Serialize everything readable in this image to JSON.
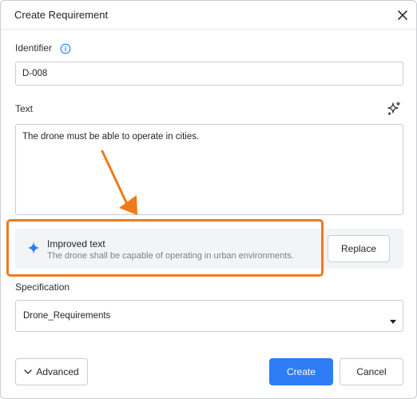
{
  "dialog": {
    "title": "Create Requirement",
    "close_icon": "close-icon"
  },
  "identifier": {
    "label": "Identifier",
    "info_icon": "info-icon",
    "value": "D-008"
  },
  "text_field": {
    "label": "Text",
    "ai_icon": "sparkle-icon",
    "value": "The drone must be able to operate in cities."
  },
  "suggestion": {
    "icon": "sparkle-icon",
    "title": "Improved text",
    "text": "The drone shall be capable of operating in urban environments.",
    "replace_label": "Replace",
    "highlight_color": "#f07a1a"
  },
  "specification": {
    "label": "Specification",
    "selected": "Drone_Requirements",
    "caret_icon": "caret-down-icon"
  },
  "footer": {
    "advanced_label": "Advanced",
    "advanced_icon": "chevron-down-icon",
    "create_label": "Create",
    "cancel_label": "Cancel"
  },
  "colors": {
    "primary": "#2f7df6",
    "annotation": "#f07a1a",
    "border": "#c9ccd1"
  }
}
